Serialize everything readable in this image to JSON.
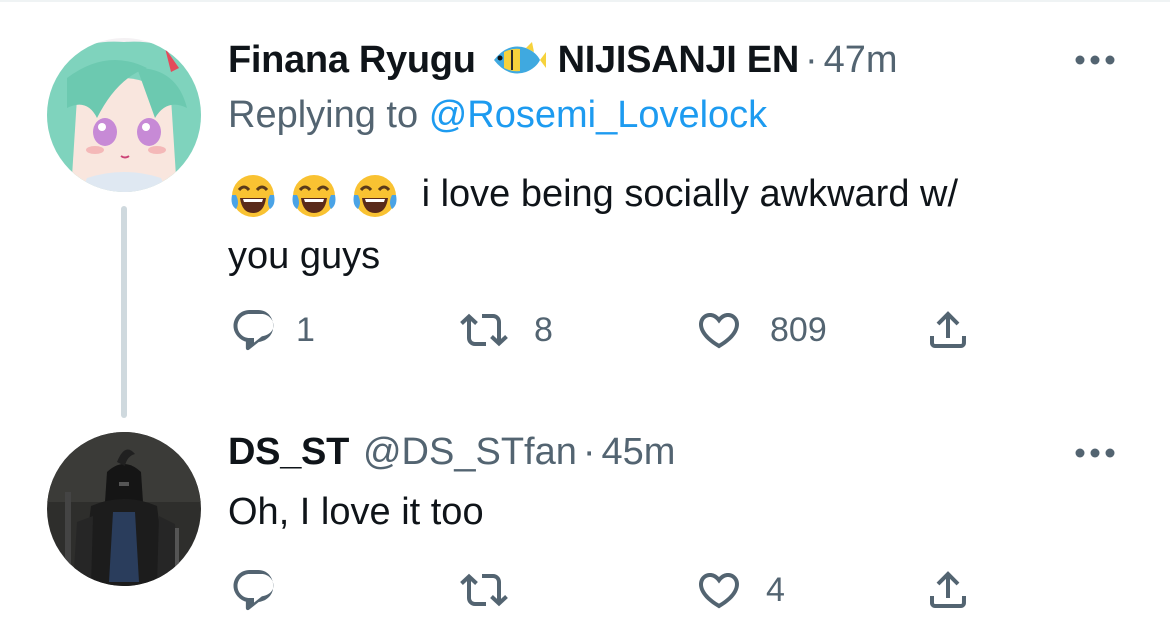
{
  "colors": {
    "text": "#0f1419",
    "secondary": "#536471",
    "link": "#1d9bf0",
    "thread_line": "#cfd9de"
  },
  "tweets": [
    {
      "display_name": "Finana Ryugu",
      "badge_icon": "tropical-fish-icon",
      "affiliation": "NIJISANJI EN",
      "separator": "·",
      "time": "47m",
      "replying_prefix": "Replying to",
      "replying_to": "@Rosemi_Lovelock",
      "emojis": [
        "face-with-tears-of-joy-icon",
        "face-with-tears-of-joy-icon",
        "face-with-tears-of-joy-icon"
      ],
      "text_line1": "i love being socially awkward w/",
      "text_line2": "you guys",
      "actions": {
        "reply_icon": "reply-icon",
        "reply_count": "1",
        "retweet_icon": "retweet-icon",
        "retweet_count": "8",
        "like_icon": "heart-icon",
        "like_count": "809",
        "share_icon": "share-icon"
      }
    },
    {
      "display_name": "DS_ST",
      "handle": "@DS_STfan",
      "separator": "·",
      "time": "45m",
      "text": "Oh, I love it too",
      "actions": {
        "reply_icon": "reply-icon",
        "reply_count": "",
        "retweet_icon": "retweet-icon",
        "retweet_count": "",
        "like_icon": "heart-icon",
        "like_count": "4",
        "share_icon": "share-icon"
      }
    }
  ]
}
